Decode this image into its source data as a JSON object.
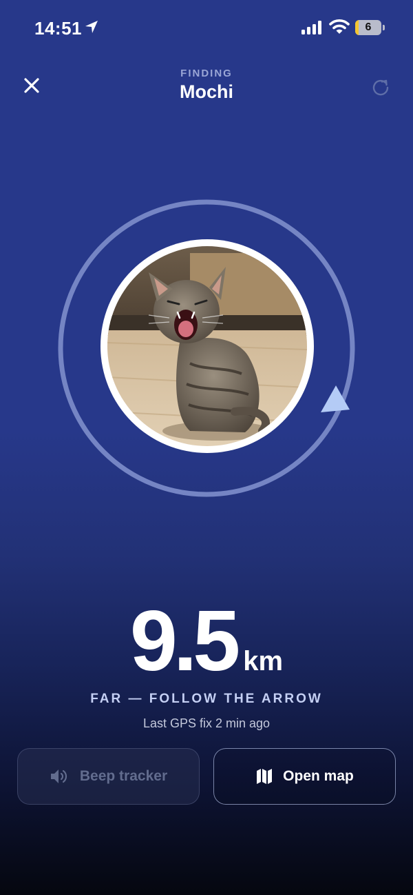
{
  "status_bar": {
    "time": "14:51",
    "battery_percent": "6",
    "battery_color": "#f4c531"
  },
  "header": {
    "eyebrow": "FINDING",
    "pet_name": "Mochi",
    "close_icon": "close-icon",
    "refresh_icon": "refresh-icon"
  },
  "finder": {
    "pet_photo": "kitten-photo",
    "direction_indicator": "direction-arrow-icon",
    "distance_value": "9.5",
    "distance_unit": "km",
    "proximity_label": "FAR — FOLLOW THE ARROW",
    "last_fix": "Last GPS fix 2 min ago"
  },
  "actions": {
    "beep_label": "Beep tracker",
    "beep_icon": "speaker-icon",
    "beep_enabled": false,
    "map_label": "Open map",
    "map_icon": "map-icon"
  },
  "colors": {
    "background": "#27388a",
    "ring": "#7585c4",
    "arrow": "#b4cbf6"
  }
}
